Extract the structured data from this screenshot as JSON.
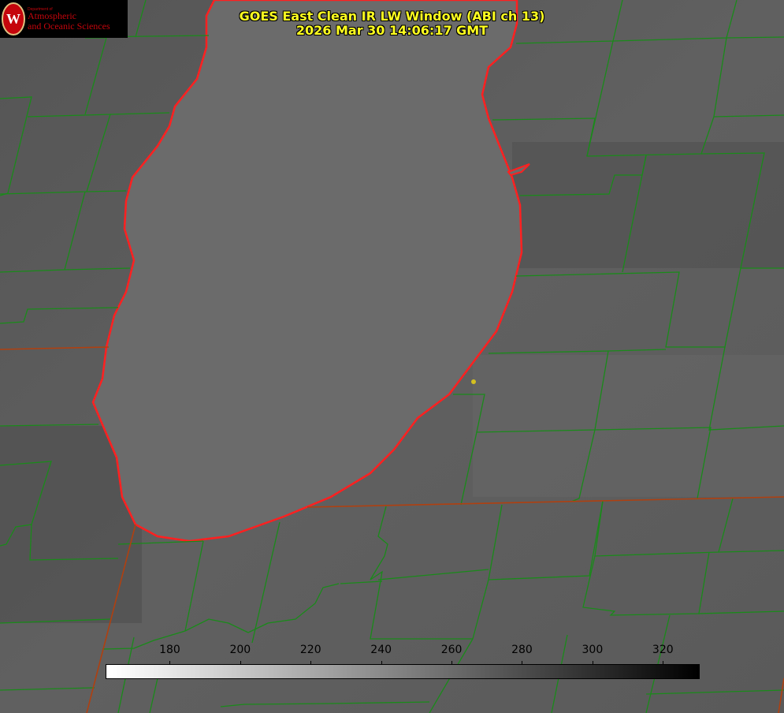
{
  "title": {
    "line1": "GOES East Clean IR LW Window (ABI ch 13)",
    "line2": "2026 Mar 30 14:06:17 GMT"
  },
  "logo": {
    "department": "Department of",
    "name_line1": "Atmospheric",
    "name_line2": "and Oceanic Sciences",
    "seal_letter": "W",
    "icon": "uw-crest-icon"
  },
  "colorbar": {
    "min": 162,
    "max": 330,
    "ticks": [
      "180",
      "200",
      "220",
      "240",
      "260",
      "280",
      "300",
      "320"
    ],
    "tick_values": [
      180,
      200,
      220,
      240,
      260,
      280,
      300,
      320
    ],
    "palette": "white-to-black"
  },
  "colors": {
    "title": "#ffff20",
    "county_lines": "#1a8a1a",
    "coastline": "#ff2020",
    "state_lines": "#b04010",
    "station_marker": "#d4c020"
  }
}
